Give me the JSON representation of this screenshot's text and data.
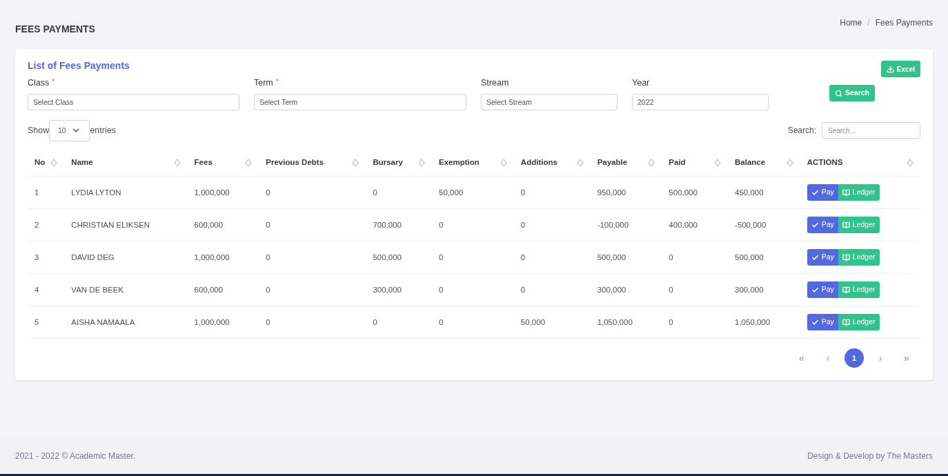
{
  "page_title": "FEES PAYMENTS",
  "breadcrumb": {
    "separator": "/",
    "items": [
      "Home",
      "Fees Payments"
    ]
  },
  "card": {
    "title": "List of Fees Payments",
    "export_button": "Excel",
    "search_button": "Search"
  },
  "filters": [
    {
      "label": "Class",
      "required_mark": "*",
      "placeholder": "Select Class"
    },
    {
      "label": "Term",
      "required_mark": "*",
      "placeholder": "Select Term"
    },
    {
      "label": "Stream",
      "placeholder": "Select Stream"
    },
    {
      "label": "Year",
      "value": "2022"
    }
  ],
  "length_menu": {
    "before": "Show",
    "value": "10",
    "after": "entries"
  },
  "table_search": {
    "label": "Search:",
    "placeholder": "Search..."
  },
  "table": {
    "columns": [
      "No",
      "Name",
      "Fees",
      "Previous Debts",
      "Bursary",
      "Exemption",
      "Additions",
      "Payable",
      "Paid",
      "Balance",
      "ACTIONS"
    ],
    "rows": [
      {
        "cells": [
          "1",
          "LYDIA LYTON",
          "1,000,000",
          "0",
          "0",
          "50,000",
          "0",
          "950,000",
          "500,000",
          "450,000"
        ],
        "actions": [
          "Pay",
          "Ledger"
        ]
      },
      {
        "cells": [
          "2",
          "CHRISTIAN ELIKSEN",
          "600,000",
          "0",
          "700,000",
          "0",
          "0",
          "-100,000",
          "400,000",
          "-500,000"
        ],
        "actions": [
          "Pay",
          "Ledger"
        ]
      },
      {
        "cells": [
          "3",
          "DAVID DEG",
          "1,000,000",
          "0",
          "500,000",
          "0",
          "0",
          "500,000",
          "0",
          "500,000"
        ],
        "actions": [
          "Pay",
          "Ledger"
        ]
      },
      {
        "cells": [
          "4",
          "VAN DE BEEK",
          "600,000",
          "0",
          "300,000",
          "0",
          "0",
          "300,000",
          "0",
          "300,000"
        ],
        "actions": [
          "Pay",
          "Ledger"
        ]
      },
      {
        "cells": [
          "5",
          "AISHA NAMAALA",
          "1,000,000",
          "0",
          "0",
          "0",
          "50,000",
          "1,050,000",
          "0",
          "1,050,000"
        ],
        "actions": [
          "Pay",
          "Ledger"
        ]
      }
    ]
  },
  "pagination": [
    {
      "label": "«",
      "kind": "nav",
      "selected": false
    },
    {
      "label": "‹",
      "kind": "nav",
      "selected": false
    },
    {
      "label": "1",
      "kind": "page",
      "selected": true
    },
    {
      "label": "›",
      "kind": "nav",
      "selected": false
    },
    {
      "label": "»",
      "kind": "nav",
      "selected": false
    }
  ],
  "footer": {
    "left": "2021 - 2022 © Academic Master.",
    "right": "Design & Develop by The Masters"
  }
}
